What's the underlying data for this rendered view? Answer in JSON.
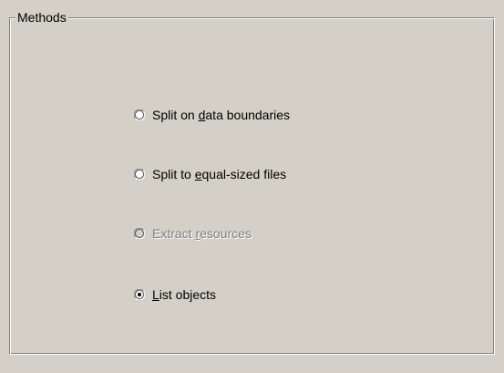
{
  "group": {
    "title": "Methods"
  },
  "options": [
    {
      "pre": "Split on ",
      "accel": "d",
      "post": "ata boundaries",
      "checked": false,
      "enabled": true
    },
    {
      "pre": "Split to ",
      "accel": "e",
      "post": "qual-sized files",
      "checked": false,
      "enabled": true
    },
    {
      "pre": "Extract ",
      "accel": "r",
      "post": "esources",
      "checked": false,
      "enabled": false
    },
    {
      "pre": "",
      "accel": "L",
      "post": "ist objects",
      "checked": true,
      "enabled": true
    }
  ],
  "colors": {
    "face": "#d4d0c8",
    "shadow": "#808080",
    "dark_shadow": "#404040",
    "highlight": "#ffffff",
    "disabled_text": "#808080"
  }
}
